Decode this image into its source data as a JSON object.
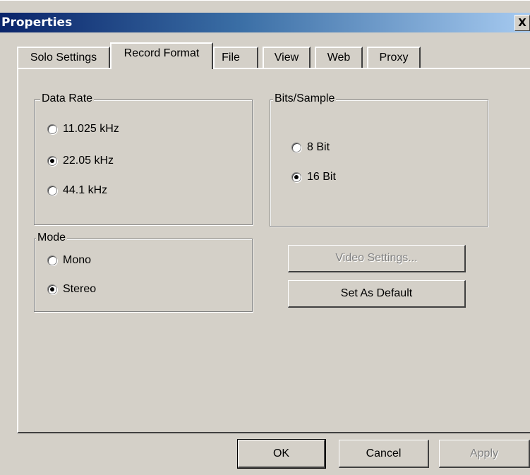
{
  "window": {
    "title": "Properties",
    "close_glyph": "X"
  },
  "tabs": [
    {
      "label": "Solo Settings",
      "active": false
    },
    {
      "label": "Record Format",
      "active": true
    },
    {
      "label": "File",
      "active": false
    },
    {
      "label": "View",
      "active": false
    },
    {
      "label": "Web",
      "active": false
    },
    {
      "label": "Proxy",
      "active": false
    }
  ],
  "data_rate": {
    "label": "Data Rate",
    "options": [
      {
        "label": "11.025 kHz",
        "selected": false
      },
      {
        "label": "22.05 kHz",
        "selected": true
      },
      {
        "label": "44.1 kHz",
        "selected": false
      }
    ]
  },
  "bits_sample": {
    "label": "Bits/Sample",
    "options": [
      {
        "label": "8 Bit",
        "selected": false
      },
      {
        "label": "16 Bit",
        "selected": true
      }
    ]
  },
  "mode": {
    "label": "Mode",
    "options": [
      {
        "label": "Mono",
        "selected": false
      },
      {
        "label": "Stereo",
        "selected": true
      }
    ]
  },
  "buttons": {
    "video_settings": "Video Settings...",
    "set_as_default": "Set As Default",
    "ok": "OK",
    "cancel": "Cancel",
    "apply": "Apply"
  }
}
